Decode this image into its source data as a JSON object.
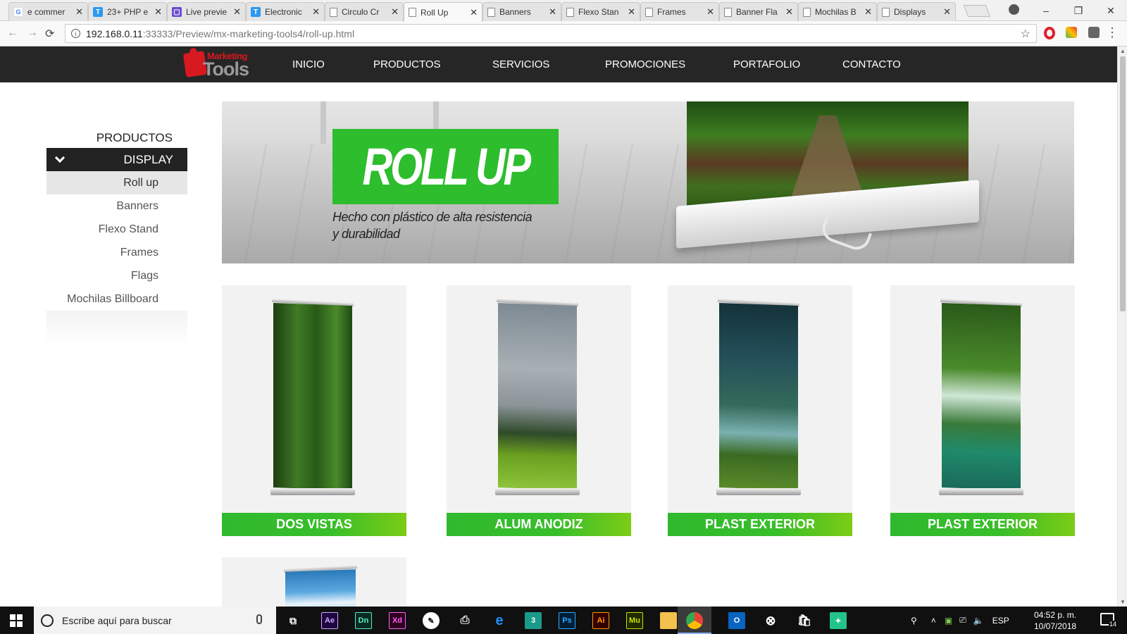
{
  "browser": {
    "tabs": [
      {
        "title": "e commer",
        "icon": "google-icon"
      },
      {
        "title": "23+ PHP e",
        "icon": "t-icon"
      },
      {
        "title": "Live previe",
        "icon": "live-preview-icon"
      },
      {
        "title": "Electronic",
        "icon": "t-icon"
      },
      {
        "title": "Circulo Cr",
        "icon": "page-icon"
      },
      {
        "title": "Roll Up",
        "icon": "page-icon"
      },
      {
        "title": "Banners",
        "icon": "page-icon"
      },
      {
        "title": "Flexo Stan",
        "icon": "page-icon"
      },
      {
        "title": "Frames",
        "icon": "page-icon"
      },
      {
        "title": "Banner Fla",
        "icon": "page-icon"
      },
      {
        "title": "Mochilas B",
        "icon": "page-icon"
      },
      {
        "title": "Displays",
        "icon": "page-icon"
      }
    ],
    "active_tab": "Roll Up",
    "url_host": "192.168.0.11",
    "url_path": ":33333/Preview/mx-marketing-tools4/roll-up.html",
    "window_controls": [
      "–",
      "❐",
      "✕"
    ]
  },
  "site": {
    "logo_top": "Marketing",
    "logo_bottom": "Tools",
    "nav": [
      "INICIO",
      "PRODUCTOS",
      "SERVICIOS",
      "PROMOCIONES",
      "PORTAFOLIO",
      "CONTACTO"
    ]
  },
  "sidebar": {
    "title": "PRODUCTOS",
    "category": "DISPLAY",
    "items": [
      "Roll up",
      "Banners",
      "Flexo Stand",
      "Frames",
      "Flags",
      "Mochilas Billboard"
    ],
    "active_item": "Roll up"
  },
  "hero": {
    "title": "ROLL UP",
    "subtitle_line1": "Hecho con plástico de alta resistencia",
    "subtitle_line2": "y durabilidad"
  },
  "products": [
    {
      "label": "DOS VISTAS",
      "scene": "forest"
    },
    {
      "label": "ALUM ANODIZ",
      "scene": "granite-cliff-meadow"
    },
    {
      "label": "PLAST EXTERIOR",
      "scene": "canyon-waterfall"
    },
    {
      "label": "PLAST EXTERIOR",
      "scene": "jungle-waterfall-lake"
    },
    {
      "label": "",
      "scene": "sky-clouds"
    }
  ],
  "taskbar": {
    "search_placeholder": "Escribe aquí para buscar",
    "apps": [
      "task-view",
      "Ae",
      "Dn",
      "Xd",
      "app-icon",
      "printer",
      "edge",
      "3ds",
      "Ps",
      "Ai",
      "Mu",
      "file-explorer",
      "chrome",
      "outlook",
      "xbox",
      "store",
      "app-green"
    ],
    "language": "ESP",
    "time": "04:52 p. m.",
    "date": "10/07/2018",
    "notifications": "14"
  },
  "colors": {
    "nav_bg": "#262626",
    "brand_green": "#2dbd2d",
    "brand_red": "#d71920",
    "card_bg": "#f2f2f2"
  }
}
